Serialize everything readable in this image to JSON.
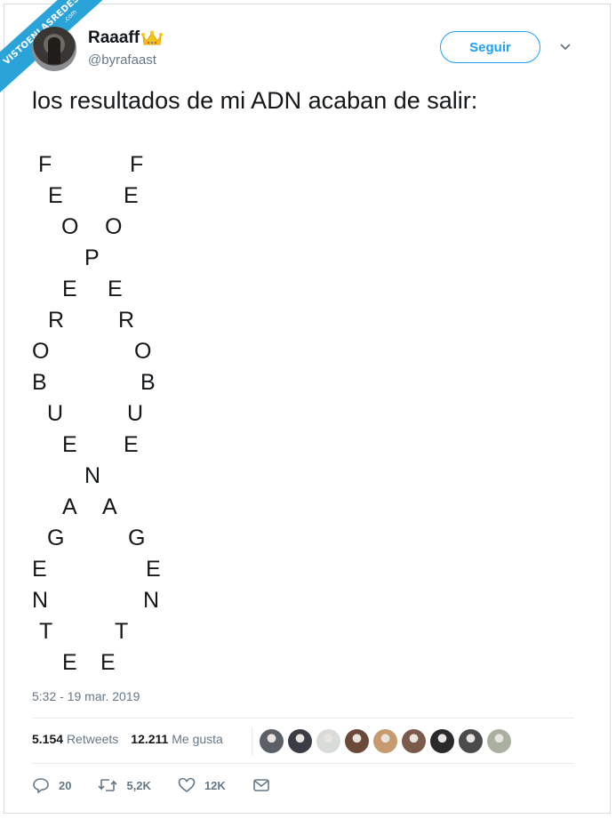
{
  "watermark": {
    "line1": "VISTOENLASREDES",
    "line2": ".com"
  },
  "user": {
    "display_name": "Raaaff",
    "handle": "@byrafaast"
  },
  "follow_button": {
    "label": "Seguir"
  },
  "tweet": {
    "text": "los resultados de mi ADN acaban de salir:",
    "dna_letters": [
      "F",
      "F",
      "E",
      "E",
      "O",
      "O",
      "P",
      "E",
      "E",
      "R",
      "R",
      "O",
      "O",
      "B",
      "B",
      "U",
      "U",
      "E",
      "E",
      "N",
      "A",
      "A",
      "G",
      "G",
      "E",
      "E",
      "N",
      "N",
      "T",
      "T",
      "E",
      "E"
    ],
    "timestamp": "5:32 - 19 mar. 2019"
  },
  "stats": {
    "retweets_count": "5.154",
    "retweets_label": "Retweets",
    "likes_count": "12.211",
    "likes_label": "Me gusta"
  },
  "likers": [
    {
      "color": "#5b5f66"
    },
    {
      "color": "#3a3d44"
    },
    {
      "color": "#d8dcd9"
    },
    {
      "color": "#6b4a3a"
    },
    {
      "color": "#c79a6f"
    },
    {
      "color": "#7a5a4a"
    },
    {
      "color": "#2a2a2c"
    },
    {
      "color": "#4b4b4e"
    },
    {
      "color": "#a9b0a0"
    }
  ],
  "actions": {
    "reply_count": "20",
    "retweet_count": "5,2K",
    "like_count": "12K"
  },
  "colors": {
    "accent": "#1da1f2",
    "muted": "#657786",
    "text": "#14171a",
    "watermark": "#2aa3d9"
  }
}
